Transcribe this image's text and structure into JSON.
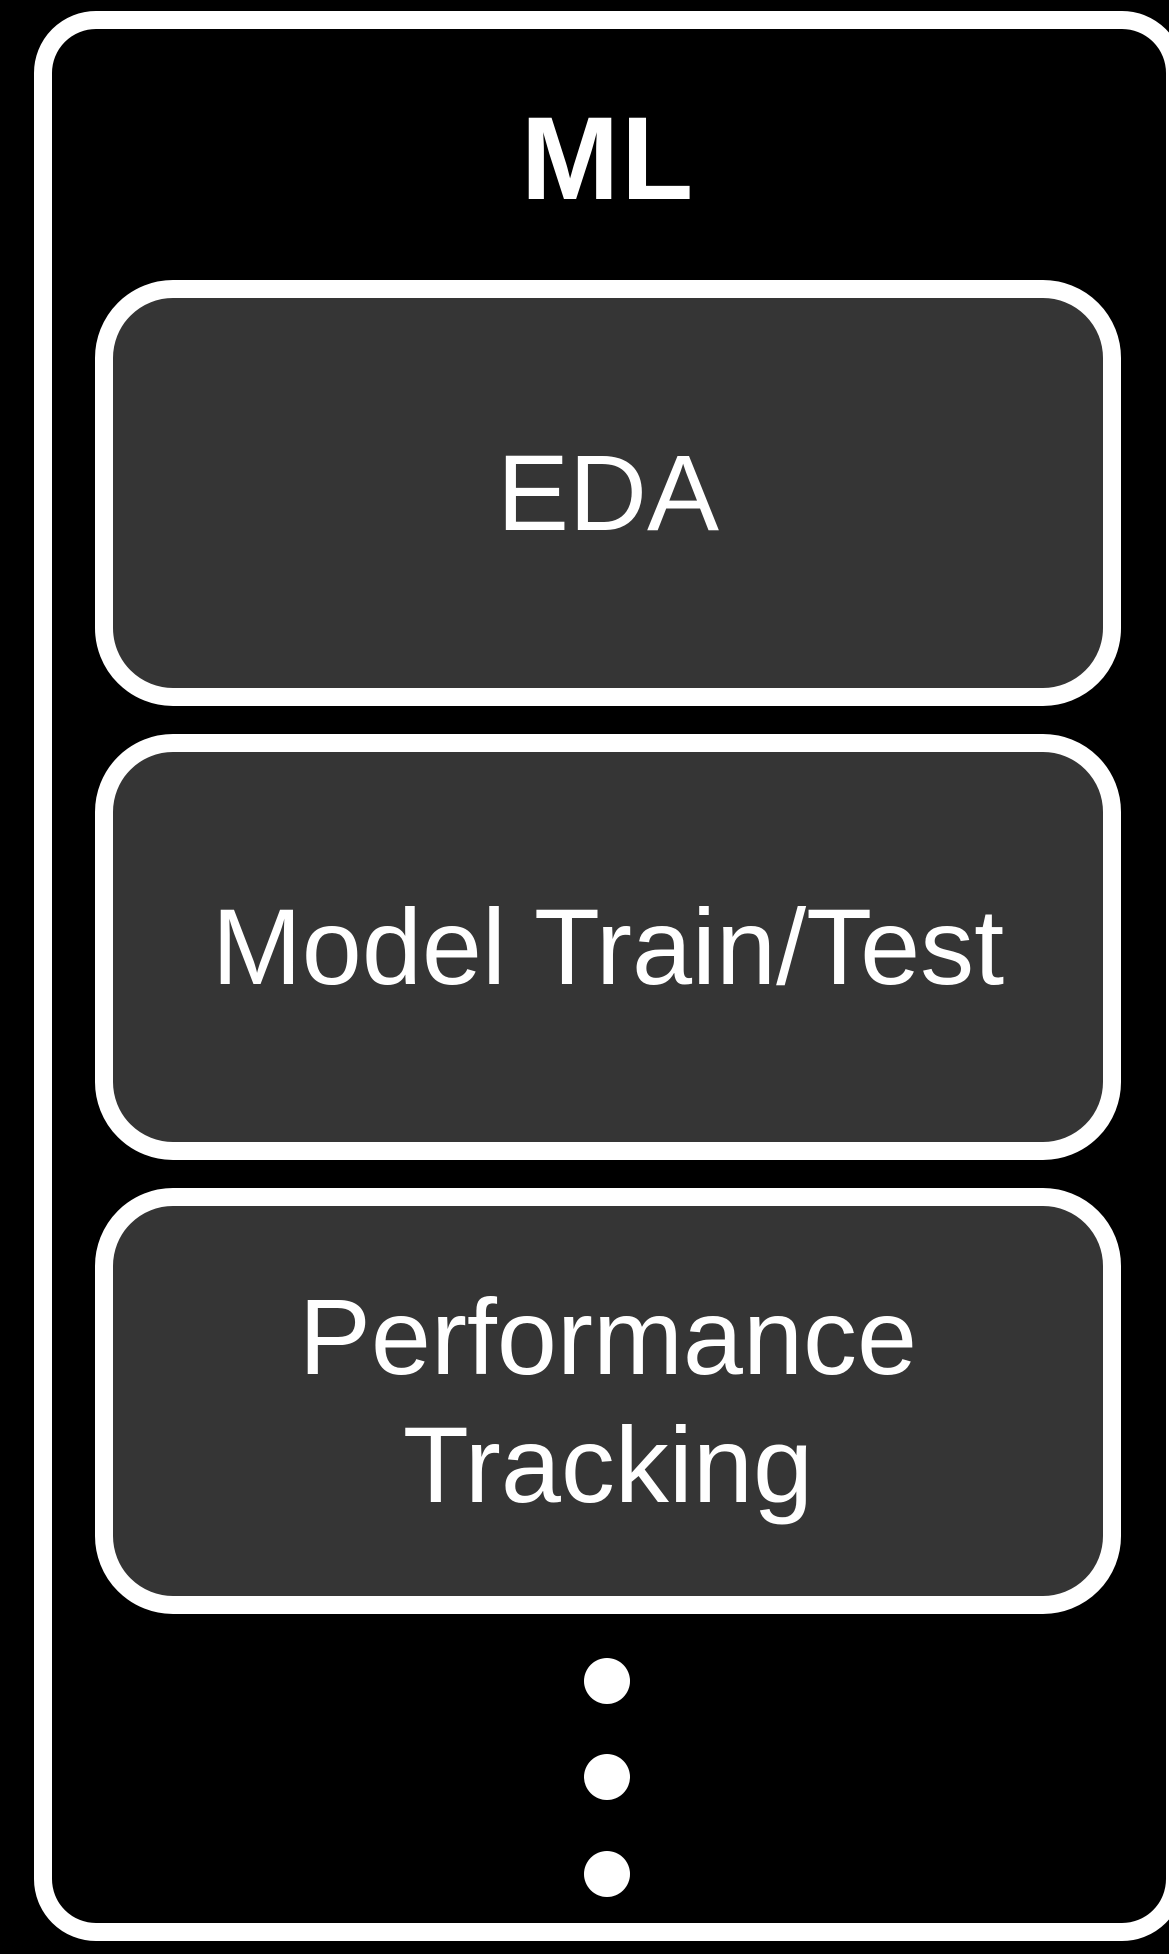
{
  "diagram": {
    "title": "ML",
    "stages": [
      {
        "label": "EDA"
      },
      {
        "label": "Model Train/Test"
      },
      {
        "label": "Performance\nTracking"
      }
    ],
    "continuation_icon": "vertical-ellipsis-icon",
    "colors": {
      "background": "#000000",
      "border": "#ffffff",
      "stage_fill": "#353535",
      "text": "#ffffff"
    }
  }
}
